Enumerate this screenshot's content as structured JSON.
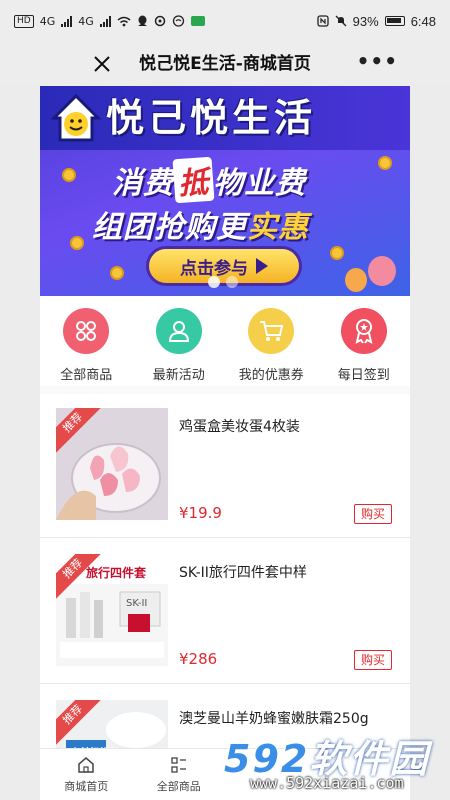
{
  "status_bar": {
    "hd": "HD",
    "signal1": "4G",
    "signal2": "4G",
    "battery_pct": "93%",
    "time": "6:48"
  },
  "nav": {
    "title": "悦己悦E生活-商城首页",
    "more": "•••"
  },
  "banner": {
    "brand": "悦己悦生活",
    "line1_a": "消费",
    "line1_hl": "抵",
    "line1_b": "物业费",
    "line2_a": "组团抢购更",
    "line2_hl": "实惠",
    "button": "点击参与"
  },
  "menu": [
    {
      "label": "全部商品",
      "color": "#f06070"
    },
    {
      "label": "最新活动",
      "color": "#36c9a3"
    },
    {
      "label": "我的优惠券",
      "color": "#f6cf4a"
    },
    {
      "label": "每日签到",
      "color": "#f05060"
    }
  ],
  "products": [
    {
      "badge": "推荐",
      "name": "鸡蛋盒美妆蛋4枚装",
      "price": "¥19.9",
      "buy": "购买"
    },
    {
      "badge": "推荐",
      "name": "SK-II旅行四件套中样",
      "price": "¥286",
      "buy": "购买"
    },
    {
      "badge": "推荐",
      "name": "澳芝曼山羊奶蜂蜜嫩肤霜250g",
      "price": "",
      "buy": ""
    }
  ],
  "product_art": {
    "skii_box": "旅行四件套",
    "sk_brand": "SK-II",
    "cream_tag": "山羊奶嫩肤"
  },
  "tabbar": [
    {
      "label": "商城首页"
    },
    {
      "label": "全部商品"
    }
  ],
  "watermark": {
    "num": "592",
    "text": "软件园",
    "url": "www.592xiazai.com"
  },
  "colors": {
    "accent": "#e0282e",
    "banner": "#5a45e0"
  }
}
